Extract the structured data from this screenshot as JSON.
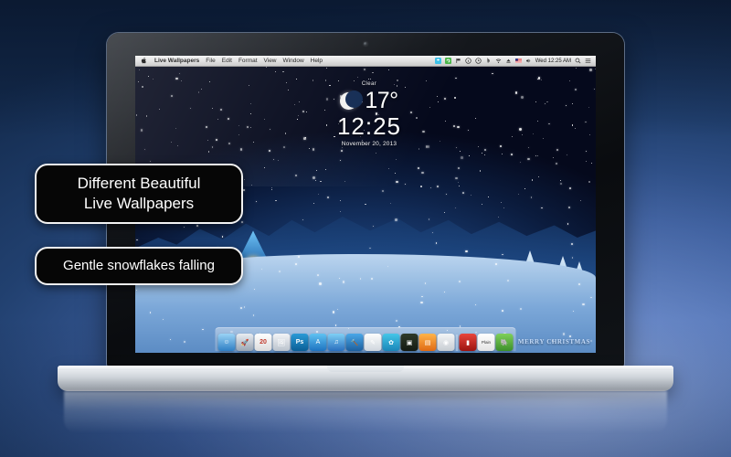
{
  "promo": {
    "callouts": [
      {
        "line1": "Different Beautiful",
        "line2": "Live Wallpapers"
      },
      {
        "line1": "Gentle snowflakes falling",
        "line2": ""
      }
    ]
  },
  "menubar": {
    "apple_logo": "",
    "items": [
      "Live Wallpapers",
      "File",
      "Edit",
      "Format",
      "View",
      "Window",
      "Help"
    ],
    "status_icons": [
      "dropbox-icon",
      "sync-icon",
      "flag-icon",
      "info-icon",
      "timemachine-icon",
      "bluetooth-icon",
      "wifi-icon",
      "eject-icon",
      "us-flag-icon",
      "volume-icon"
    ],
    "clock": "Wed 12:25 AM",
    "search_icon": "search-icon",
    "notification_icon": "notification-list-icon"
  },
  "widget": {
    "condition": "Clear",
    "icon": "crescent-moon-icon",
    "temperature": "17°",
    "time": "12:25",
    "date": "November 20, 2013"
  },
  "wallpaper": {
    "scene_caption": "MERRY CHRISTMAS",
    "theme": "Snowy Christmas Village"
  },
  "dock": {
    "items": [
      {
        "name": "finder",
        "label": "Finder",
        "color1": "#9ad3f5",
        "color2": "#2f7fc4",
        "glyph": "☺",
        "running": true
      },
      {
        "name": "launchpad",
        "label": "Launchpad",
        "color1": "#e9edf2",
        "color2": "#9aa6b4",
        "glyph": "🚀",
        "running": false
      },
      {
        "name": "calendar",
        "label": "Calendar",
        "color1": "#ffffff",
        "color2": "#dcdcdc",
        "glyph": "20",
        "running": false
      },
      {
        "name": "preview",
        "label": "Preview",
        "color1": "#f2f4f7",
        "color2": "#b9c2cc",
        "glyph": "🖼",
        "running": false
      },
      {
        "name": "photoshop",
        "label": "Photoshop",
        "color1": "#2a9ad6",
        "color2": "#0a5e96",
        "glyph": "Ps",
        "running": false
      },
      {
        "name": "app-store",
        "label": "App Store",
        "color1": "#5fc2f2",
        "color2": "#1e73c0",
        "glyph": "A",
        "running": true
      },
      {
        "name": "itunes",
        "label": "iTunes",
        "color1": "#7fd0f5",
        "color2": "#2a6fbe",
        "glyph": "♫",
        "running": false
      },
      {
        "name": "xcode",
        "label": "Xcode",
        "color1": "#4aa7e8",
        "color2": "#1c5f9e",
        "glyph": "🔨",
        "running": false
      },
      {
        "name": "textedit",
        "label": "TextEdit",
        "color1": "#fdfdfd",
        "color2": "#cfd6de",
        "glyph": "✎",
        "running": false
      },
      {
        "name": "live-wallpapers",
        "label": "Live Wallpapers",
        "color1": "#45c6e8",
        "color2": "#1a86b8",
        "glyph": "✿",
        "running": true
      },
      {
        "name": "gameboy",
        "label": "Game",
        "color1": "#2e3a2a",
        "color2": "#141a12",
        "glyph": "▣",
        "running": false
      },
      {
        "name": "ibooks",
        "label": "iBooks",
        "color1": "#ffb44a",
        "color2": "#e06a14",
        "glyph": "▤",
        "running": false
      },
      {
        "name": "chrome",
        "label": "Chrome",
        "color1": "#f3f5f7",
        "color2": "#c7ccd2",
        "glyph": "◉",
        "running": true
      },
      {
        "name": "red-app",
        "label": "Utility",
        "color1": "#e8453c",
        "color2": "#9c1410",
        "glyph": "▮",
        "running": false
      },
      {
        "name": "plain",
        "label": "Plain",
        "color1": "#ffffff",
        "color2": "#e4e4e4",
        "glyph": "Plain",
        "running": false
      },
      {
        "name": "evernote",
        "label": "Evernote",
        "color1": "#7fd05a",
        "color2": "#3c8f2a",
        "glyph": "🐘",
        "running": false
      }
    ]
  }
}
